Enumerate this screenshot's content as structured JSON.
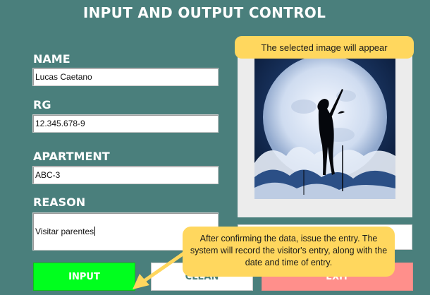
{
  "window": {
    "title": "INPUT AND OUTPUT CONTROL"
  },
  "form": {
    "name_label": "NAME",
    "name_value": "Lucas Caetano",
    "rg_label": "RG",
    "rg_value": "12.345.678-9",
    "apartment_label": "APARTMENT",
    "apartment_value": "ABC-3",
    "reason_label": "REASON",
    "reason_value": "Visitar parentes"
  },
  "buttons": {
    "input": "INPUT",
    "clean": "CLEAN",
    "exit": "EXIT"
  },
  "tooltips": {
    "image": "The selected image will appear",
    "entry": "After confirming the data, issue the entry. The system will record the visitor's entry, along with the date and time of entry."
  },
  "colors": {
    "background": "#4a7f7c",
    "input_button": "#00ff1e",
    "exit_button": "#ff8f8b",
    "tooltip": "#ffd75e"
  },
  "icons": {
    "photo": "moonlit-silhouette-image",
    "pointer": "arrow-icon"
  }
}
